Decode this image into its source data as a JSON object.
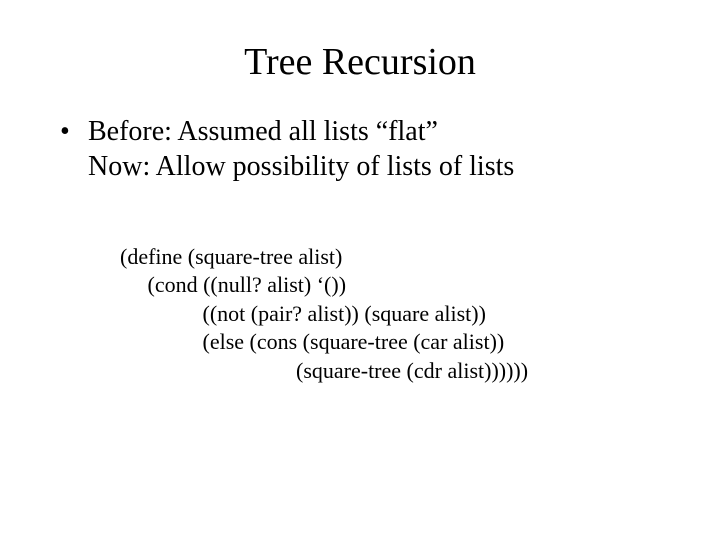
{
  "title": "Tree Recursion",
  "bullet": {
    "line1": "Before: Assumed all lists “flat”",
    "line2": "Now: Allow possibility of lists of lists"
  },
  "code": {
    "l1": "(define (square-tree alist)",
    "l2": "     (cond ((null? alist) ‘())",
    "l3": "               ((not (pair? alist)) (square alist))",
    "l4": "               (else (cons (square-tree (car alist))",
    "l5": "                                (square-tree (cdr alist))))))"
  }
}
